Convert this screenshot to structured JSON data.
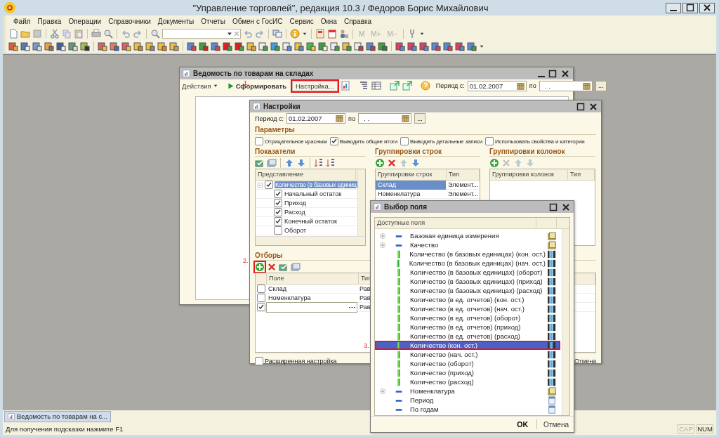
{
  "window": {
    "title": "\"Управление торговлей\", редакция 10.3 / Федоров Борис Михайлович"
  },
  "menu": [
    "Файл",
    "Правка",
    "Операции",
    "Справочники",
    "Документы",
    "Отчеты",
    "Обмен с ГосИС",
    "Сервис",
    "Окна",
    "Справка"
  ],
  "toolbar": {
    "memory_buttons": [
      {
        "label": "M",
        "disabled": true
      },
      {
        "label": "M+",
        "disabled": true
      },
      {
        "label": "M−",
        "disabled": true
      }
    ]
  },
  "report_window": {
    "title": "Ведомость по товарам на складах",
    "actions_menu": "Действия",
    "generate_button": "Сформировать",
    "settings_button": {
      "label": "Настройка...",
      "highlighted": true
    },
    "period_label": "Период с:",
    "period_from": "01.02.2007",
    "period_to_label": "по",
    "period_to": ". .",
    "select_button": "..."
  },
  "settings_window": {
    "title": "Настройки",
    "period_label": "Период с:",
    "period_from": "01.02.2007",
    "period_to_label": "по",
    "period_to": ". .",
    "select_button": "...",
    "params_heading": "Параметры",
    "params": [
      {
        "label": "Отрицательное красным",
        "checked": false
      },
      {
        "label": "Выводить общие итоги",
        "checked": true
      },
      {
        "label": "Выводить детальные записи",
        "checked": false
      },
      {
        "label": "Использовать свойства и категории",
        "checked": false
      }
    ],
    "indicators": {
      "heading": "Показатели",
      "column": "Представление",
      "tree": [
        {
          "label": "Количество (в базовых единиц",
          "checked": true,
          "expanded": true,
          "selected": true,
          "children": [
            {
              "label": "Начальный остаток",
              "checked": true
            },
            {
              "label": "Приход",
              "checked": true
            },
            {
              "label": "Расход",
              "checked": true
            },
            {
              "label": "Конечный остаток",
              "checked": true
            },
            {
              "label": "Оборот",
              "checked": false
            }
          ]
        }
      ]
    },
    "row_groupings": {
      "heading": "Группировки строк",
      "columns": [
        "Группировки строк",
        "Тип"
      ],
      "rows": [
        {
          "cells": [
            "Склад",
            "Элемент..."
          ],
          "selected": true
        },
        {
          "cells": [
            "Номенклатура",
            "Элемент..."
          ],
          "selected": false
        }
      ]
    },
    "column_groupings": {
      "heading": "Группировки колонок",
      "columns": [
        "Группировки колонок",
        "Тип"
      ]
    },
    "filters": {
      "heading": "Отборы",
      "add_highlighted": true,
      "columns": [
        "Поле",
        "Тип"
      ],
      "rows": [
        {
          "checked": false,
          "field": "Склад",
          "type": "Рав"
        },
        {
          "checked": false,
          "field": "Номенклатура",
          "type": "Рав"
        },
        {
          "checked": true,
          "editing": true,
          "type": "Рав"
        }
      ]
    },
    "extended": {
      "label": "Расширенная настройка",
      "checked": false
    },
    "cancel_button": "Отмена"
  },
  "field_chooser": {
    "title": "Выбор поля",
    "column": "Доступные поля",
    "items": [
      {
        "kind": "group",
        "label": "Базовая единица измерения",
        "selected": false
      },
      {
        "kind": "group",
        "label": "Качество",
        "selected": false
      },
      {
        "kind": "number",
        "label": "Количество (в базовых единицах) (кон. ост.)",
        "selected": false
      },
      {
        "kind": "number",
        "label": "Количество (в базовых единицах) (нач. ост.)",
        "selected": false
      },
      {
        "kind": "number",
        "label": "Количество (в базовых единицах) (оборот)",
        "selected": false
      },
      {
        "kind": "number",
        "label": "Количество (в базовых единицах) (приход)",
        "selected": false
      },
      {
        "kind": "number",
        "label": "Количество (в базовых единицах) (расход)",
        "selected": false
      },
      {
        "kind": "number",
        "label": "Количество (в ед. отчетов) (кон. ост.)",
        "selected": false
      },
      {
        "kind": "number",
        "label": "Количество (в ед. отчетов) (нач. ост.)",
        "selected": false
      },
      {
        "kind": "number",
        "label": "Количество (в ед. отчетов) (оборот)",
        "selected": false
      },
      {
        "kind": "number",
        "label": "Количество (в ед. отчетов) (приход)",
        "selected": false
      },
      {
        "kind": "number",
        "label": "Количество (в ед. отчетов) (расход)",
        "selected": false
      },
      {
        "kind": "number",
        "label": "Количество (кон. ост.)",
        "selected": true,
        "highlighted": true
      },
      {
        "kind": "number",
        "label": "Количество (нач. ост.)",
        "selected": false
      },
      {
        "kind": "number",
        "label": "Количество (оборот)",
        "selected": false
      },
      {
        "kind": "number",
        "label": "Количество (приход)",
        "selected": false
      },
      {
        "kind": "number",
        "label": "Количество (расход)",
        "selected": false
      },
      {
        "kind": "group",
        "label": "Номенклатура",
        "selected": false
      },
      {
        "kind": "date",
        "label": "Период",
        "selected": false
      },
      {
        "kind": "date",
        "label": "По годам",
        "selected": false
      }
    ],
    "ok_button": "OK",
    "cancel_button": "Отмена"
  },
  "annotations": [
    "1.",
    "2.",
    "3."
  ],
  "taskbar": [
    {
      "label": "Ведомость по товарам на с...",
      "selected": true
    }
  ],
  "status_bar": {
    "hint": "Для получения подсказки нажмите F1",
    "indicators": [
      {
        "label": "CAP",
        "disabled": true
      },
      {
        "label": "NUM",
        "disabled": false
      }
    ]
  }
}
